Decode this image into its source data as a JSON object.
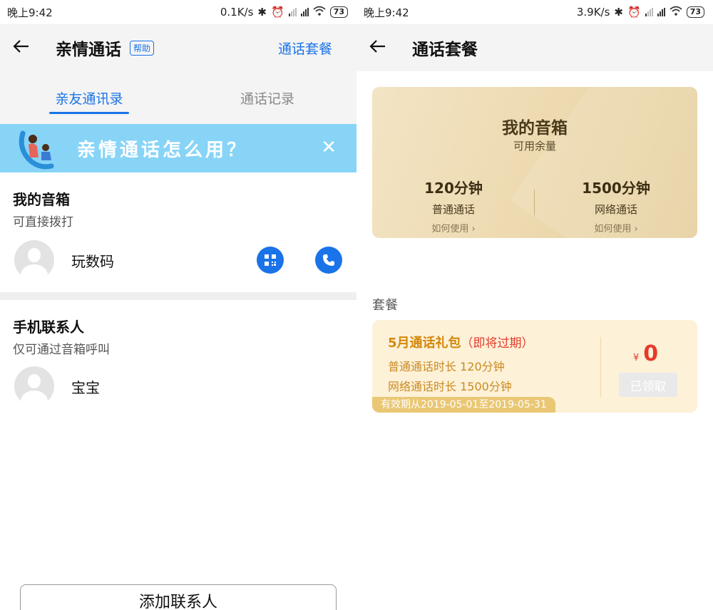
{
  "left": {
    "status": {
      "time": "晚上9:42",
      "speed": "0.1K/s",
      "battery": "73"
    },
    "appbar": {
      "title": "亲情通话",
      "help": "帮助",
      "link": "通话套餐"
    },
    "tabs": [
      {
        "label": "亲友通讯录",
        "active": true
      },
      {
        "label": "通话记录",
        "active": false
      }
    ],
    "banner": {
      "text": "亲情通话怎么用？"
    },
    "my_speaker": {
      "title": "我的音箱",
      "subtitle": "可直接拨打",
      "contact": {
        "name": "玩数码"
      }
    },
    "phone_contacts": {
      "title": "手机联系人",
      "subtitle": "仅可通过音箱呼叫",
      "contact": {
        "name": "宝宝"
      }
    },
    "add_button": "添加联系人"
  },
  "right": {
    "status": {
      "time": "晚上9:42",
      "speed": "3.9K/s",
      "battery": "73"
    },
    "appbar": {
      "title": "通话套餐"
    },
    "balance_card": {
      "title": "我的音箱",
      "subtitle": "可用余量",
      "normal": {
        "value": "120分钟",
        "label": "普通通话",
        "help": "如何使用"
      },
      "network": {
        "value": "1500分钟",
        "label": "网络通话",
        "help": "如何使用"
      }
    },
    "package_section_label": "套餐",
    "package": {
      "title": "5月通话礼包",
      "warning": "（即将过期）",
      "line1": "普通通话时长 120分钟",
      "line2": "网络通话时长 1500分钟",
      "validity": "有效期从2019-05-01至2019-05-31",
      "currency": "¥",
      "price": "0",
      "button": "已领取"
    }
  },
  "colors": {
    "accent": "#1a73e8",
    "banner": "#87d4f7",
    "gold_card": "#ecd8ad",
    "package_bg": "#fdf1d8",
    "price": "#e53a2b"
  }
}
